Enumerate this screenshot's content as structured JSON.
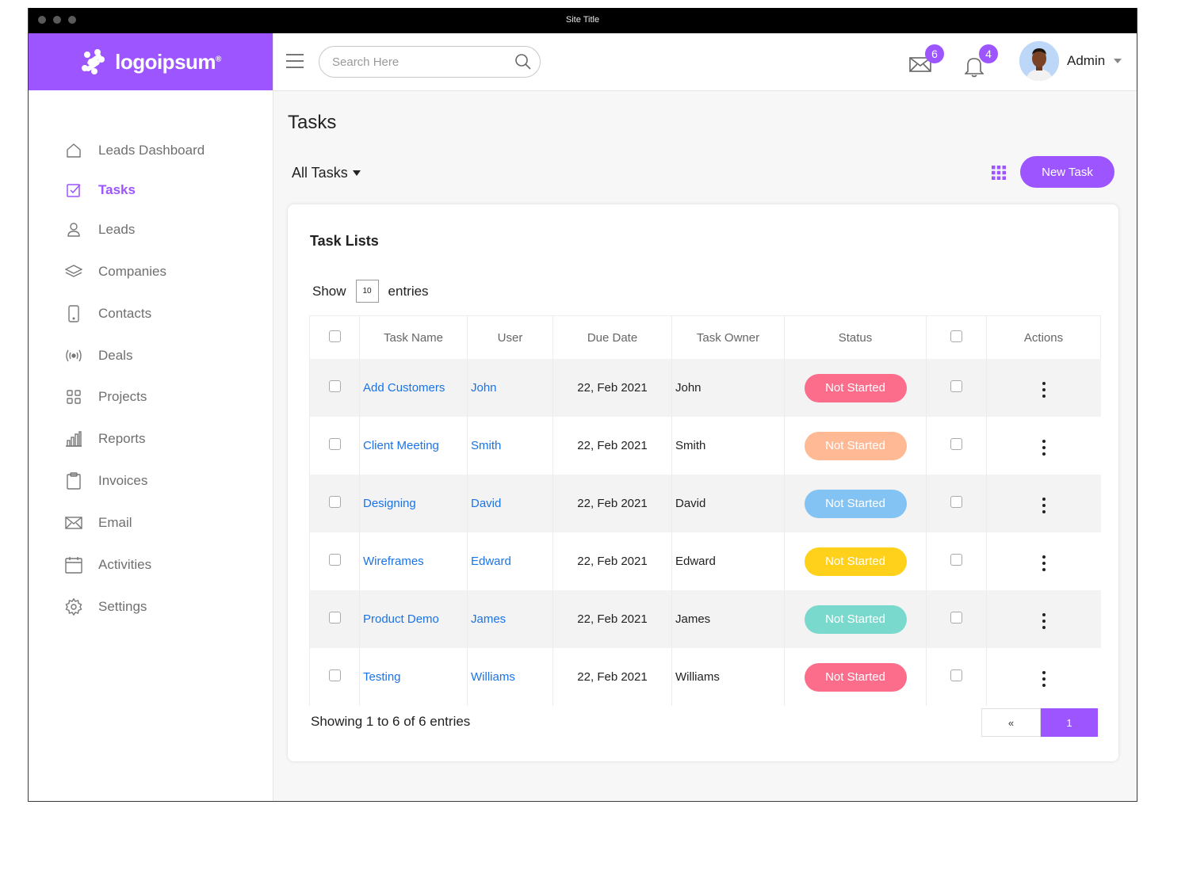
{
  "window": {
    "title": "Site Title"
  },
  "brand": {
    "name": "logoipsum",
    "trademark": "®",
    "color": "#9c55ff"
  },
  "sidebar": {
    "items": [
      {
        "label": "Leads Dashboard",
        "icon": "home-icon",
        "active": false
      },
      {
        "label": "Tasks",
        "icon": "checkbox-icon",
        "active": true
      },
      {
        "label": "Leads",
        "icon": "user-icon",
        "active": false
      },
      {
        "label": "Companies",
        "icon": "layers-icon",
        "active": false
      },
      {
        "label": "Contacts",
        "icon": "phone-icon",
        "active": false
      },
      {
        "label": "Deals",
        "icon": "broadcast-icon",
        "active": false
      },
      {
        "label": "Projects",
        "icon": "grid-icon",
        "active": false
      },
      {
        "label": "Reports",
        "icon": "bar-chart-icon",
        "active": false
      },
      {
        "label": "Invoices",
        "icon": "clipboard-icon",
        "active": false
      },
      {
        "label": "Email",
        "icon": "mail-icon",
        "active": false
      },
      {
        "label": "Activities",
        "icon": "calendar-icon",
        "active": false
      },
      {
        "label": "Settings",
        "icon": "gear-icon",
        "active": false
      }
    ]
  },
  "header": {
    "search_placeholder": "Search Here",
    "messages_count": "6",
    "notifications_count": "4",
    "user_name": "Admin"
  },
  "page": {
    "title": "Tasks",
    "filter_label": "All Tasks",
    "new_task_label": "New Task"
  },
  "card": {
    "title": "Task Lists",
    "show_label": "Show",
    "entries_value": "10",
    "entries_label": "entries",
    "footer": "Showing 1 to 6 of 6 entries",
    "pagination": {
      "prev": "«",
      "current": "1"
    }
  },
  "table": {
    "columns": [
      "Task Name",
      "User",
      "Due Date",
      "Task Owner",
      "Status",
      "Actions"
    ],
    "rows": [
      {
        "task": "Add Customers",
        "user": "John",
        "due": "22, Feb 2021",
        "owner": "John",
        "status": "Not Started",
        "status_color": "#fb6d8b"
      },
      {
        "task": "Client Meeting",
        "user": "Smith",
        "due": "22, Feb 2021",
        "owner": "Smith",
        "status": "Not Started",
        "status_color": "#ffb994"
      },
      {
        "task": "Designing",
        "user": "David",
        "due": "22, Feb 2021",
        "owner": "David",
        "status": "Not Started",
        "status_color": "#83c3f4"
      },
      {
        "task": "Wireframes",
        "user": "Edward",
        "due": "22, Feb 2021",
        "owner": "Edward",
        "status": "Not Started",
        "status_color": "#ffd11a"
      },
      {
        "task": "Product Demo",
        "user": "James",
        "due": "22, Feb 2021",
        "owner": "James",
        "status": "Not Started",
        "status_color": "#7ad9cd"
      },
      {
        "task": "Testing",
        "user": "Williams",
        "due": "22, Feb 2021",
        "owner": "Williams",
        "status": "Not Started",
        "status_color": "#fb6d8b"
      }
    ]
  }
}
